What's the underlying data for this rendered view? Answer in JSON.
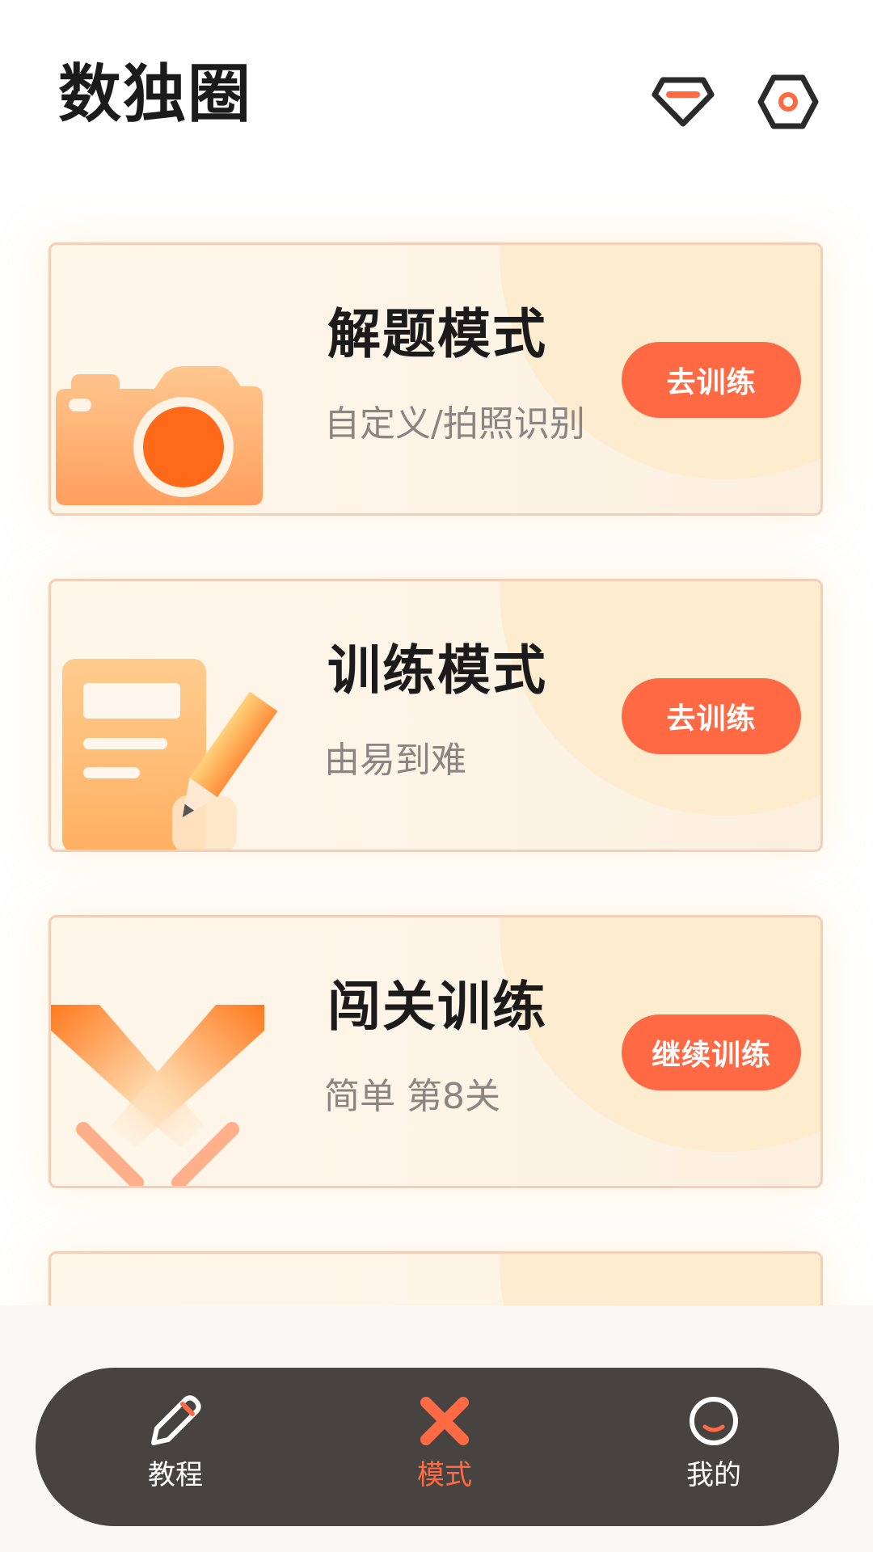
{
  "header": {
    "title": "数独圈",
    "icons": [
      "diamond-icon",
      "settings-icon"
    ]
  },
  "cards": [
    {
      "title": "解题模式",
      "subtitle": "自定义/拍照识别",
      "button": "去训练",
      "icon": "camera-icon"
    },
    {
      "title": "训练模式",
      "subtitle": "由易到难",
      "button": "去训练",
      "icon": "notebook-pencil-icon"
    },
    {
      "title": "闯关训练",
      "subtitle": "简单  第8关",
      "button": "继续训练",
      "icon": "crossed-swords-icon"
    }
  ],
  "nav": {
    "items": [
      {
        "label": "教程",
        "icon": "pencil-icon",
        "active": false
      },
      {
        "label": "模式",
        "icon": "x-mode-icon",
        "active": true
      },
      {
        "label": "我的",
        "icon": "smile-circle-icon",
        "active": false
      }
    ]
  },
  "colors": {
    "accent": "#ff6a45",
    "nav_background": "#474340",
    "card_border": "#f6cdb6"
  }
}
